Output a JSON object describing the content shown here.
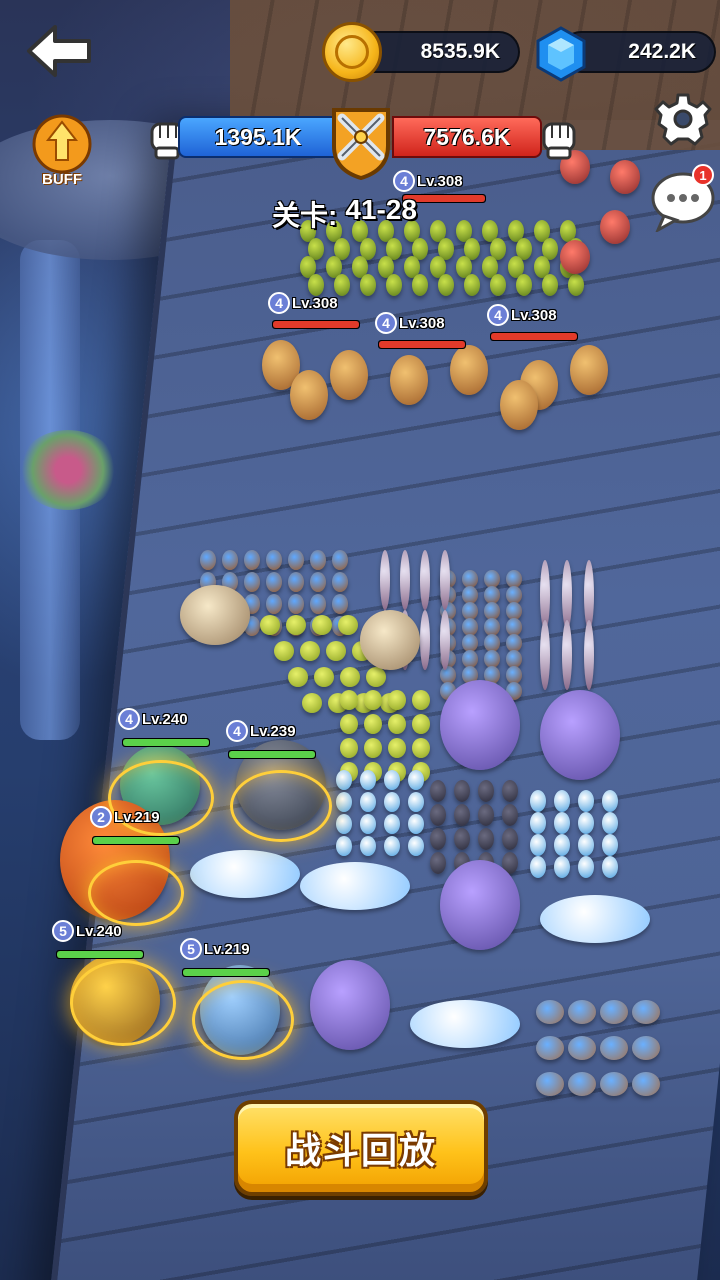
{
  "hud": {
    "coins": "8535.9K",
    "gems": "242.2K",
    "ally_power": "1395.1K",
    "enemy_power": "7576.6K",
    "stage_label": "关卡:",
    "stage_value": "41-28",
    "buff_label": "BUFF",
    "chat_badge": "1",
    "replay_button": "战斗回放"
  },
  "colors": {
    "ally_bar": "#2f7be6",
    "enemy_bar": "#e2322a",
    "gold": "#ffc21a",
    "ally_hp": "#5bd14a",
    "enemy_hp": "#e23a2a"
  },
  "enemy_heroes": [
    {
      "star": "4",
      "level": "Lv.308"
    },
    {
      "star": "4",
      "level": "Lv.308"
    },
    {
      "star": "4",
      "level": "Lv.308"
    },
    {
      "star": "4",
      "level": "Lv.308"
    }
  ],
  "ally_heroes": [
    {
      "star": "4",
      "level": "Lv.240"
    },
    {
      "star": "4",
      "level": "Lv.239"
    },
    {
      "star": "2",
      "level": "Lv.219"
    },
    {
      "star": "5",
      "level": "Lv.240"
    },
    {
      "star": "5",
      "level": "Lv.219"
    }
  ],
  "icons": [
    "back-arrow-icon",
    "coin-icon",
    "gem-icon",
    "fist-icon",
    "crossed-swords-icon",
    "buff-icon",
    "gear-icon",
    "chat-icon"
  ]
}
